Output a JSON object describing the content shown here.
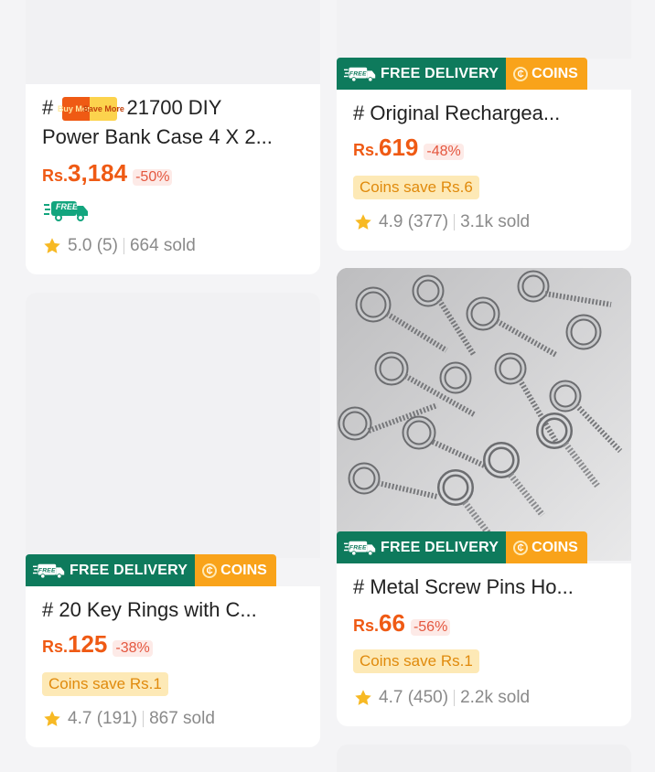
{
  "banner": {
    "free_delivery": "FREE DELIVERY",
    "coins": "COINS"
  },
  "products": [
    {
      "title_prefix": "#",
      "badge_buy_more": "Buy More",
      "badge_save_more": "Save More",
      "title": "21700 DIY",
      "title_line2": "Power Bank Case 4 X 2...",
      "currency": "Rs.",
      "price": "3,184",
      "discount": "-50%",
      "free_badge": "FREE",
      "rating": "5.0",
      "reviews": "(5)",
      "sold": "664 sold"
    },
    {
      "title": "# Original Rechargea...",
      "currency": "Rs.",
      "price": "619",
      "discount": "-48%",
      "coins_save": "Coins save Rs.6",
      "rating": "4.9",
      "reviews": "(377)",
      "sold": "3.1k sold"
    },
    {
      "title": "# 20 Key Rings with C...",
      "currency": "Rs.",
      "price": "125",
      "discount": "-38%",
      "coins_save": "Coins save Rs.1",
      "rating": "4.7",
      "reviews": "(191)",
      "sold": "867 sold"
    },
    {
      "title": "# Metal Screw Pins Ho...",
      "currency": "Rs.",
      "price": "66",
      "discount": "-56%",
      "coins_save": "Coins save Rs.1",
      "rating": "4.7",
      "reviews": "(450)",
      "sold": "2.2k sold"
    }
  ],
  "colors": {
    "accent_price": "#ef5a14",
    "free_delivery_green": "#0e7a5c",
    "coins_orange": "#f9a31a",
    "coins_save_bg": "#fde9b6",
    "star": "#f7b924"
  }
}
